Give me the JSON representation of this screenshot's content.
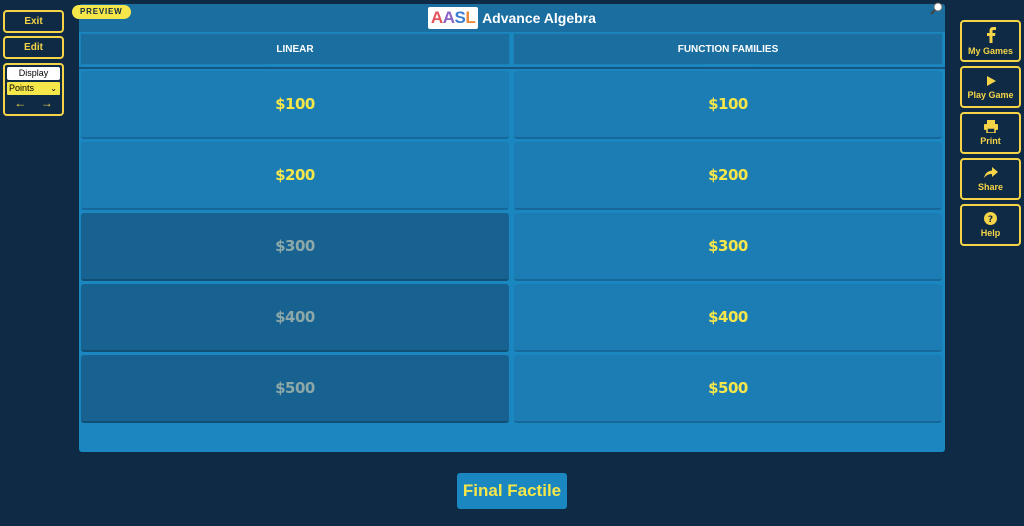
{
  "left_controls": {
    "exit_label": "Exit",
    "edit_label": "Edit",
    "display_label": "Display",
    "display_mode": "Points",
    "prev_arrow": "←",
    "next_arrow": "→"
  },
  "board": {
    "preview_tag": "PREVIEW",
    "logo_letters": [
      "A",
      "A",
      "S",
      "L"
    ],
    "title": "Advance Algebra",
    "categories": [
      {
        "name": "LINEAR",
        "cells": [
          {
            "value": "$100",
            "used": false
          },
          {
            "value": "$200",
            "used": false
          },
          {
            "value": "$300",
            "used": true
          },
          {
            "value": "$400",
            "used": true
          },
          {
            "value": "$500",
            "used": true
          }
        ]
      },
      {
        "name": "FUNCTION FAMILIES",
        "cells": [
          {
            "value": "$100",
            "used": false
          },
          {
            "value": "$200",
            "used": false
          },
          {
            "value": "$300",
            "used": false
          },
          {
            "value": "$400",
            "used": false
          },
          {
            "value": "$500",
            "used": false
          }
        ]
      }
    ]
  },
  "right_controls": [
    {
      "label": "My Games",
      "icon": "facebook-icon"
    },
    {
      "label": "Play Game",
      "icon": "play-icon"
    },
    {
      "label": "Print",
      "icon": "print-icon"
    },
    {
      "label": "Share",
      "icon": "share-icon"
    },
    {
      "label": "Help",
      "icon": "help-icon"
    }
  ],
  "final_button_label": "Final Factile",
  "colors": {
    "background": "#0f2a44",
    "board": "#1b87c0",
    "accent_yellow": "#f5d547",
    "value_yellow": "#f5e64a",
    "used_cell": "#176290"
  }
}
